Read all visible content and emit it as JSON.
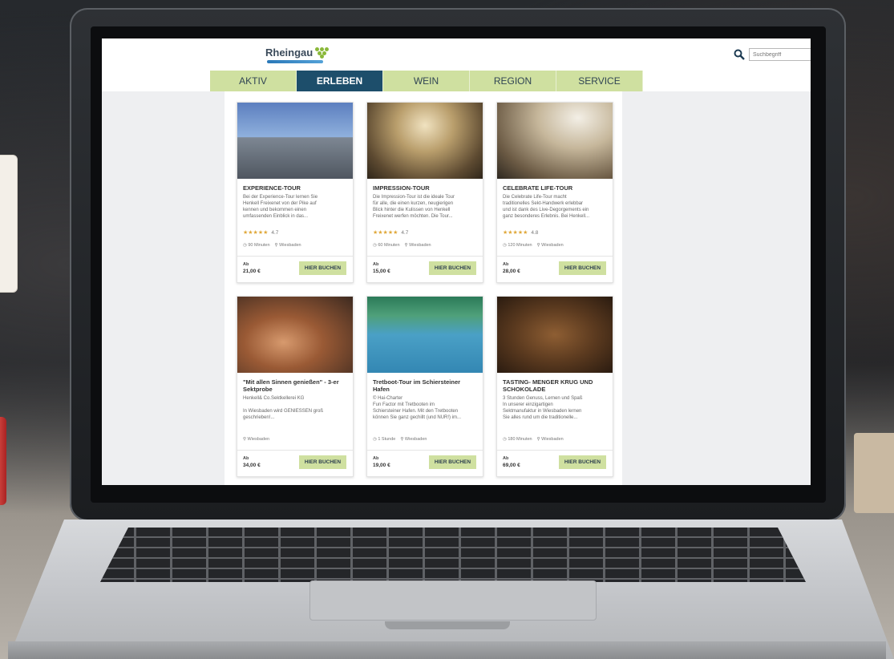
{
  "site": {
    "logo_text": "Rheingau",
    "search_placeholder": "Suchbegriff"
  },
  "nav": {
    "items": [
      {
        "label": "AKTIV",
        "active": false
      },
      {
        "label": "ERLEBEN",
        "active": true
      },
      {
        "label": "WEIN",
        "active": false
      },
      {
        "label": "REGION",
        "active": false
      },
      {
        "label": "SERVICE",
        "active": false
      }
    ]
  },
  "colors": {
    "nav_bg": "#cfe0a0",
    "nav_active_bg": "#1d4e6b",
    "button_bg": "#cfe0a0",
    "star": "#e0a83a"
  },
  "cards": [
    {
      "title": "EXPERIENCE-TOUR",
      "desc_lines": [
        "Bei der Experience-Tour lernen Sie",
        "Henkell Freixenet von der Pike auf",
        "kennen und bekommen einen",
        "umfassenden Einblick in das..."
      ],
      "stars": "★★★★★",
      "rating": "4.7",
      "meta": [
        "◷ 90 Minuten",
        "⚲ Wiesbaden"
      ],
      "price_label": "Ab",
      "price": "21,00 €",
      "button": "HIER BUCHEN"
    },
    {
      "title": "IMPRESSION-TOUR",
      "desc_lines": [
        "Die Impression-Tour ist die ideale Tour",
        "für alle, die einen kurzen, neugierigen",
        "Blick hinter die Kulissen von Henkell",
        "Freixenet werfen möchten. Die Tour..."
      ],
      "stars": "★★★★★",
      "rating": "4.7",
      "meta": [
        "◷ 60 Minuten",
        "⚲ Wiesbaden"
      ],
      "price_label": "Ab",
      "price": "15,00 €",
      "button": "HIER BUCHEN"
    },
    {
      "title": "CELEBRATE LIFE-TOUR",
      "desc_lines": [
        "Die Celebrate Life-Tour macht",
        "traditionelles Sekt-Handwerk erlebbar",
        "und ist dank des Live-Degorgements ein",
        "ganz besonderes Erlebnis. Bei Henkell..."
      ],
      "stars": "★★★★★",
      "rating": "4.8",
      "meta": [
        "◷ 120 Minuten",
        "⚲ Wiesbaden"
      ],
      "price_label": "Ab",
      "price": "28,00 €",
      "button": "HIER BUCHEN"
    },
    {
      "title": "\"Mit allen Sinnen genießen\" - 3-er Sektprobe",
      "desc_lines": [
        "Henkell& Co.Sektkellerei KG",
        "",
        "In Wiesbaden wird GENIESSEN groß",
        "geschrieben!..."
      ],
      "stars": "",
      "rating": "",
      "meta": [
        "⚲ Wiesbaden"
      ],
      "price_label": "Ab",
      "price": "34,00 €",
      "button": "HIER BUCHEN"
    },
    {
      "title": "Tretboot-Tour im Schiersteiner Hafen",
      "desc_lines": [
        "© Hai-Charter",
        "Fun Factor mit Tretbooten im",
        "Schiersteiner Hafen. Mit den Tretbooten",
        "können Sie ganz gechillt (und NUR!) im..."
      ],
      "stars": "",
      "rating": "",
      "meta": [
        "◷ 1 Stunde",
        "⚲ Wiesbaden"
      ],
      "price_label": "Ab",
      "price": "19,00 €",
      "button": "HIER BUCHEN"
    },
    {
      "title": "TASTING- MENGER KRUG UND SCHOKOLADE",
      "desc_lines": [
        "3 Stunden Genuss, Lernen und Spaß",
        "In unserer einzigartigen",
        "Sektmanufaktur in Wiesbaden lernen",
        "Sie alles rund um die traditionelle..."
      ],
      "stars": "",
      "rating": "",
      "meta": [
        "◷ 180 Minuten",
        "⚲ Wiesbaden"
      ],
      "price_label": "Ab",
      "price": "69,00 €",
      "button": "HIER BUCHEN"
    }
  ]
}
